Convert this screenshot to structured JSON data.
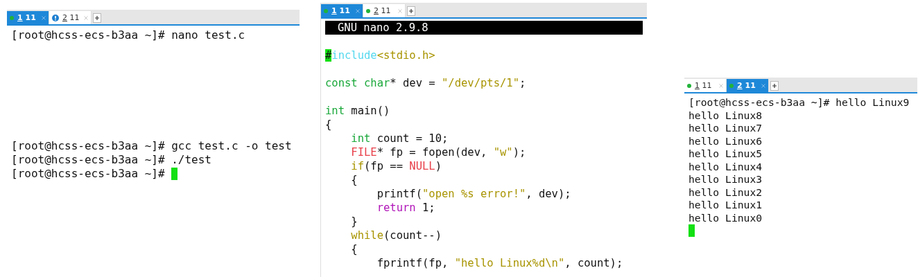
{
  "panes": [
    {
      "kind": "shell",
      "tabs": [
        {
          "label": "1 11",
          "kind": "dot",
          "selected": true
        },
        {
          "label": "2 11",
          "kind": "alert",
          "selected": false
        }
      ],
      "lines": [
        {
          "kind": "text",
          "tokens": [
            {
              "t": "[root@hcss-ecs-b3aa ~]# nano test.c",
              "kind": "plain"
            }
          ]
        },
        {
          "kind": "blank"
        },
        {
          "kind": "blank"
        },
        {
          "kind": "blank"
        },
        {
          "kind": "blank"
        },
        {
          "kind": "blank"
        },
        {
          "kind": "blank"
        },
        {
          "kind": "blank"
        },
        {
          "kind": "text",
          "tokens": [
            {
              "t": "[root@hcss-ecs-b3aa ~]# gcc test.c -o test",
              "kind": "plain"
            }
          ]
        },
        {
          "kind": "text",
          "tokens": [
            {
              "t": "[root@hcss-ecs-b3aa ~]# ./test",
              "kind": "plain"
            }
          ]
        },
        {
          "kind": "text",
          "tokens": [
            {
              "t": "[root@hcss-ecs-b3aa ~]#",
              "kind": "plain"
            }
          ],
          "cursor": true
        }
      ]
    },
    {
      "kind": "editor",
      "header": "GNU nano 2.9.8",
      "tabs": [
        {
          "label": "1 11",
          "kind": "dot",
          "selected": true
        },
        {
          "label": "2 11",
          "kind": "dot",
          "selected": false
        }
      ],
      "lines": [
        {
          "kind": "text",
          "tokens": [
            {
              "t": "#",
              "kind": "cursor"
            },
            {
              "t": "include",
              "kind": "pre"
            },
            {
              "t": "<stdio.h>",
              "kind": "str"
            }
          ]
        },
        {
          "kind": "blank"
        },
        {
          "kind": "text",
          "tokens": [
            {
              "t": "const char",
              "kind": "type"
            },
            {
              "t": "* dev = ",
              "kind": "plain"
            },
            {
              "t": "\"/dev/pts/1\"",
              "kind": "str"
            },
            {
              "t": ";",
              "kind": "plain"
            }
          ]
        },
        {
          "kind": "blank"
        },
        {
          "kind": "text",
          "tokens": [
            {
              "t": "int",
              "kind": "type"
            },
            {
              "t": " main()",
              "kind": "plain"
            }
          ]
        },
        {
          "kind": "text",
          "tokens": [
            {
              "t": "{",
              "kind": "plain"
            }
          ]
        },
        {
          "kind": "text",
          "tokens": [
            {
              "t": "    int",
              "kind": "type"
            },
            {
              "t": " count = 10;",
              "kind": "plain"
            }
          ]
        },
        {
          "kind": "text",
          "tokens": [
            {
              "t": "    FILE",
              "kind": "red"
            },
            {
              "t": "* fp = fopen(dev, ",
              "kind": "plain"
            },
            {
              "t": "\"w\"",
              "kind": "str"
            },
            {
              "t": ");",
              "kind": "plain"
            }
          ]
        },
        {
          "kind": "text",
          "tokens": [
            {
              "t": "    if",
              "kind": "str"
            },
            {
              "t": "(fp == ",
              "kind": "plain"
            },
            {
              "t": "NULL",
              "kind": "red"
            },
            {
              "t": ")",
              "kind": "plain"
            }
          ]
        },
        {
          "kind": "text",
          "tokens": [
            {
              "t": "    {",
              "kind": "plain"
            }
          ]
        },
        {
          "kind": "text",
          "tokens": [
            {
              "t": "        printf(",
              "kind": "plain"
            },
            {
              "t": "\"open %s error!\"",
              "kind": "str"
            },
            {
              "t": ", dev);",
              "kind": "plain"
            }
          ]
        },
        {
          "kind": "text",
          "tokens": [
            {
              "t": "        return",
              "kind": "ret"
            },
            {
              "t": " 1;",
              "kind": "plain"
            }
          ]
        },
        {
          "kind": "text",
          "tokens": [
            {
              "t": "    }",
              "kind": "plain"
            }
          ]
        },
        {
          "kind": "text",
          "tokens": [
            {
              "t": "    while",
              "kind": "str"
            },
            {
              "t": "(count--)",
              "kind": "plain"
            }
          ]
        },
        {
          "kind": "text",
          "tokens": [
            {
              "t": "    {",
              "kind": "plain"
            }
          ]
        },
        {
          "kind": "text",
          "tokens": [
            {
              "t": "        fprintf(fp, ",
              "kind": "plain"
            },
            {
              "t": "\"hello Linux%d\\n\"",
              "kind": "str"
            },
            {
              "t": ", count);",
              "kind": "plain"
            }
          ]
        }
      ]
    },
    {
      "kind": "output",
      "tabs": [
        {
          "label": "1 11",
          "kind": "dot",
          "selected": false
        },
        {
          "label": "2 11",
          "kind": "dot",
          "selected": true
        }
      ],
      "lines": [
        {
          "kind": "text",
          "tokens": [
            {
              "t": "[root@hcss-ecs-b3aa ~]# hello Linux9",
              "kind": "plain"
            }
          ]
        },
        {
          "kind": "text",
          "tokens": [
            {
              "t": "hello Linux8",
              "kind": "plain"
            }
          ]
        },
        {
          "kind": "text",
          "tokens": [
            {
              "t": "hello Linux7",
              "kind": "plain"
            }
          ]
        },
        {
          "kind": "text",
          "tokens": [
            {
              "t": "hello Linux6",
              "kind": "plain"
            }
          ]
        },
        {
          "kind": "text",
          "tokens": [
            {
              "t": "hello Linux5",
              "kind": "plain"
            }
          ]
        },
        {
          "kind": "text",
          "tokens": [
            {
              "t": "hello Linux4",
              "kind": "plain"
            }
          ]
        },
        {
          "kind": "text",
          "tokens": [
            {
              "t": "hello Linux3",
              "kind": "plain"
            }
          ]
        },
        {
          "kind": "text",
          "tokens": [
            {
              "t": "hello Linux2",
              "kind": "plain"
            }
          ]
        },
        {
          "kind": "text",
          "tokens": [
            {
              "t": "hello Linux1",
              "kind": "plain"
            }
          ]
        },
        {
          "kind": "text",
          "tokens": [
            {
              "t": "hello Linux0",
              "kind": "plain"
            }
          ]
        },
        {
          "kind": "cursor",
          "cursor": true
        }
      ]
    }
  ]
}
